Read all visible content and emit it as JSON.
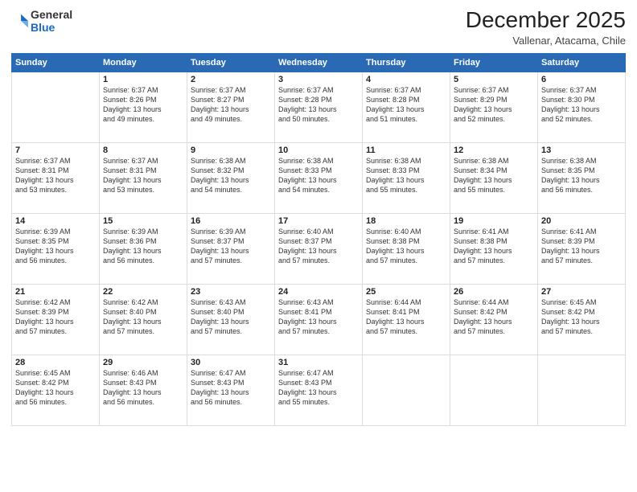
{
  "header": {
    "logo_line1": "General",
    "logo_line2": "Blue",
    "month": "December 2025",
    "location": "Vallenar, Atacama, Chile"
  },
  "weekdays": [
    "Sunday",
    "Monday",
    "Tuesday",
    "Wednesday",
    "Thursday",
    "Friday",
    "Saturday"
  ],
  "weeks": [
    [
      {
        "day": "",
        "info": ""
      },
      {
        "day": "1",
        "info": "Sunrise: 6:37 AM\nSunset: 8:26 PM\nDaylight: 13 hours\nand 49 minutes."
      },
      {
        "day": "2",
        "info": "Sunrise: 6:37 AM\nSunset: 8:27 PM\nDaylight: 13 hours\nand 49 minutes."
      },
      {
        "day": "3",
        "info": "Sunrise: 6:37 AM\nSunset: 8:28 PM\nDaylight: 13 hours\nand 50 minutes."
      },
      {
        "day": "4",
        "info": "Sunrise: 6:37 AM\nSunset: 8:28 PM\nDaylight: 13 hours\nand 51 minutes."
      },
      {
        "day": "5",
        "info": "Sunrise: 6:37 AM\nSunset: 8:29 PM\nDaylight: 13 hours\nand 52 minutes."
      },
      {
        "day": "6",
        "info": "Sunrise: 6:37 AM\nSunset: 8:30 PM\nDaylight: 13 hours\nand 52 minutes."
      }
    ],
    [
      {
        "day": "7",
        "info": "Sunrise: 6:37 AM\nSunset: 8:31 PM\nDaylight: 13 hours\nand 53 minutes."
      },
      {
        "day": "8",
        "info": "Sunrise: 6:37 AM\nSunset: 8:31 PM\nDaylight: 13 hours\nand 53 minutes."
      },
      {
        "day": "9",
        "info": "Sunrise: 6:38 AM\nSunset: 8:32 PM\nDaylight: 13 hours\nand 54 minutes."
      },
      {
        "day": "10",
        "info": "Sunrise: 6:38 AM\nSunset: 8:33 PM\nDaylight: 13 hours\nand 54 minutes."
      },
      {
        "day": "11",
        "info": "Sunrise: 6:38 AM\nSunset: 8:33 PM\nDaylight: 13 hours\nand 55 minutes."
      },
      {
        "day": "12",
        "info": "Sunrise: 6:38 AM\nSunset: 8:34 PM\nDaylight: 13 hours\nand 55 minutes."
      },
      {
        "day": "13",
        "info": "Sunrise: 6:38 AM\nSunset: 8:35 PM\nDaylight: 13 hours\nand 56 minutes."
      }
    ],
    [
      {
        "day": "14",
        "info": "Sunrise: 6:39 AM\nSunset: 8:35 PM\nDaylight: 13 hours\nand 56 minutes."
      },
      {
        "day": "15",
        "info": "Sunrise: 6:39 AM\nSunset: 8:36 PM\nDaylight: 13 hours\nand 56 minutes."
      },
      {
        "day": "16",
        "info": "Sunrise: 6:39 AM\nSunset: 8:37 PM\nDaylight: 13 hours\nand 57 minutes."
      },
      {
        "day": "17",
        "info": "Sunrise: 6:40 AM\nSunset: 8:37 PM\nDaylight: 13 hours\nand 57 minutes."
      },
      {
        "day": "18",
        "info": "Sunrise: 6:40 AM\nSunset: 8:38 PM\nDaylight: 13 hours\nand 57 minutes."
      },
      {
        "day": "19",
        "info": "Sunrise: 6:41 AM\nSunset: 8:38 PM\nDaylight: 13 hours\nand 57 minutes."
      },
      {
        "day": "20",
        "info": "Sunrise: 6:41 AM\nSunset: 8:39 PM\nDaylight: 13 hours\nand 57 minutes."
      }
    ],
    [
      {
        "day": "21",
        "info": "Sunrise: 6:42 AM\nSunset: 8:39 PM\nDaylight: 13 hours\nand 57 minutes."
      },
      {
        "day": "22",
        "info": "Sunrise: 6:42 AM\nSunset: 8:40 PM\nDaylight: 13 hours\nand 57 minutes."
      },
      {
        "day": "23",
        "info": "Sunrise: 6:43 AM\nSunset: 8:40 PM\nDaylight: 13 hours\nand 57 minutes."
      },
      {
        "day": "24",
        "info": "Sunrise: 6:43 AM\nSunset: 8:41 PM\nDaylight: 13 hours\nand 57 minutes."
      },
      {
        "day": "25",
        "info": "Sunrise: 6:44 AM\nSunset: 8:41 PM\nDaylight: 13 hours\nand 57 minutes."
      },
      {
        "day": "26",
        "info": "Sunrise: 6:44 AM\nSunset: 8:42 PM\nDaylight: 13 hours\nand 57 minutes."
      },
      {
        "day": "27",
        "info": "Sunrise: 6:45 AM\nSunset: 8:42 PM\nDaylight: 13 hours\nand 57 minutes."
      }
    ],
    [
      {
        "day": "28",
        "info": "Sunrise: 6:45 AM\nSunset: 8:42 PM\nDaylight: 13 hours\nand 56 minutes."
      },
      {
        "day": "29",
        "info": "Sunrise: 6:46 AM\nSunset: 8:43 PM\nDaylight: 13 hours\nand 56 minutes."
      },
      {
        "day": "30",
        "info": "Sunrise: 6:47 AM\nSunset: 8:43 PM\nDaylight: 13 hours\nand 56 minutes."
      },
      {
        "day": "31",
        "info": "Sunrise: 6:47 AM\nSunset: 8:43 PM\nDaylight: 13 hours\nand 55 minutes."
      },
      {
        "day": "",
        "info": ""
      },
      {
        "day": "",
        "info": ""
      },
      {
        "day": "",
        "info": ""
      }
    ]
  ]
}
